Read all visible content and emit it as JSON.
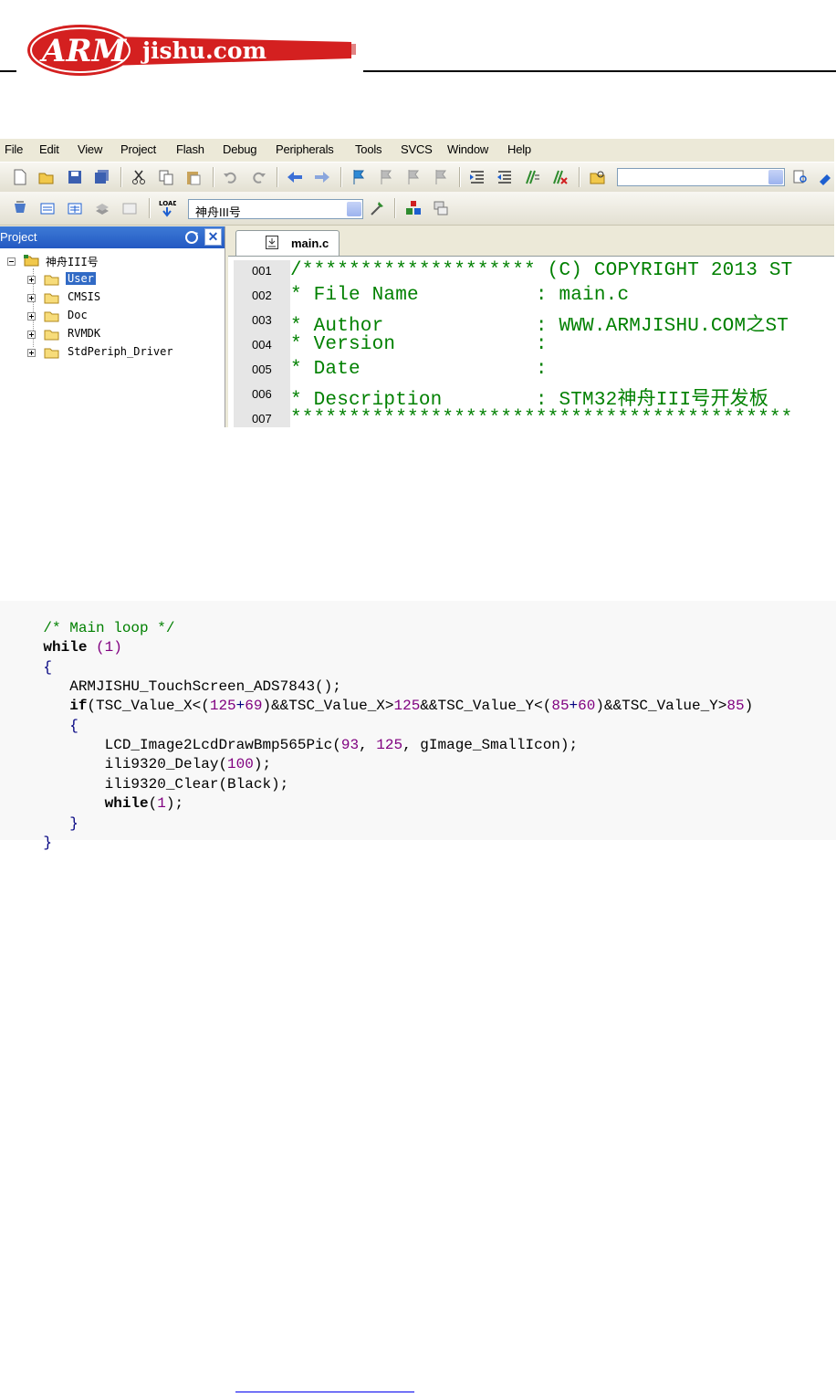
{
  "header": {
    "logo_text": "ARMjishu.com"
  },
  "ide": {
    "menu": [
      "File",
      "Edit",
      "View",
      "Project",
      "Flash",
      "Debug",
      "Peripherals",
      "Tools",
      "SVCS",
      "Window",
      "Help"
    ],
    "target_select": "神舟III号",
    "project_pane": {
      "title": "Project",
      "root": "神舟III号",
      "folders": [
        "User",
        "CMSIS",
        "Doc",
        "RVMDK",
        "StdPeriph_Driver"
      ],
      "selected": "User"
    },
    "tab": "main.c",
    "line_numbers": [
      "001",
      "002",
      "003",
      "004",
      "005",
      "006",
      "007"
    ],
    "code_lines": [
      "/******************** (C) COPYRIGHT 2013 ST",
      "* File Name          : main.c",
      "* Author             : WWW.ARMJISHU.COM之ST",
      "* Version            :",
      "* Date               :",
      "* Description        : STM32神舟III号开发板",
      "*******************************************"
    ]
  },
  "snippet": {
    "comment": "/* Main loop */",
    "while_kw": "while",
    "while_cond": " (1)",
    "brace_open": "{",
    "call1": "   ARMJISHU_TouchScreen_ADS7843();",
    "if_kw": "   if",
    "if_cond_a": "(TSC_Value_X<(",
    "if_n1": "125",
    "if_p1": "+",
    "if_n2": "69",
    "if_cond_b": ")&&TSC_Value_X>",
    "if_n3": "125",
    "if_cond_c": "&&TSC_Value_Y<(",
    "if_n4": "85",
    "if_p2": "+",
    "if_n5": "60",
    "if_cond_d": ")&&TSC_Value_Y>",
    "if_n6": "85",
    "if_cond_e": ")",
    "inner_open": "   {",
    "draw_a": "       LCD_Image2LcdDrawBmp565Pic(",
    "draw_n1": "93",
    "draw_b": ", ",
    "draw_n2": "125",
    "draw_c": ", gImage_SmallIcon);",
    "delay_a": "       ili9320_Delay(",
    "delay_n": "100",
    "delay_b": ");",
    "clear": "       ili9320_Clear(Black);",
    "while2_kw": "       while",
    "while2_a": "(",
    "while2_n": "1",
    "while2_b": ");",
    "inner_close": "   }",
    "brace_close": "}"
  }
}
